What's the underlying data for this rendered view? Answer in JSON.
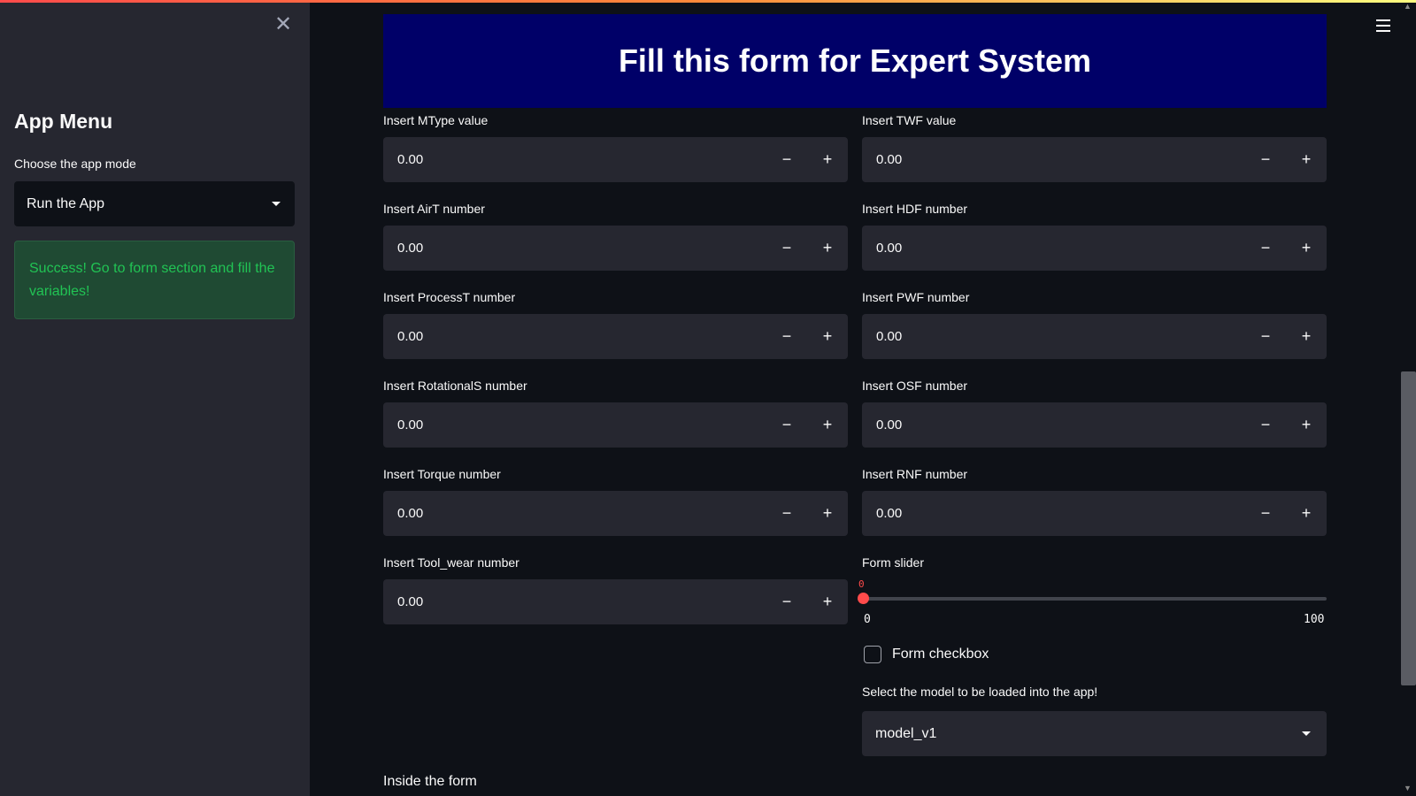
{
  "sidebar": {
    "title": "App Menu",
    "mode_label": "Choose the app mode",
    "mode_value": "Run the App",
    "success_message": "Success! Go to form section and fill the variables!"
  },
  "header": {
    "title": "Fill this form for Expert System"
  },
  "form": {
    "left_fields": [
      {
        "label": "Insert MType value",
        "value": "0.00"
      },
      {
        "label": "Insert AirT number",
        "value": "0.00"
      },
      {
        "label": "Insert ProcessT number",
        "value": "0.00"
      },
      {
        "label": "Insert RotationalS number",
        "value": "0.00"
      },
      {
        "label": "Insert Torque number",
        "value": "0.00"
      },
      {
        "label": "Insert Tool_wear number",
        "value": "0.00"
      }
    ],
    "right_fields": [
      {
        "label": "Insert TWF value",
        "value": "0.00"
      },
      {
        "label": "Insert HDF number",
        "value": "0.00"
      },
      {
        "label": "Insert PWF number",
        "value": "0.00"
      },
      {
        "label": "Insert OSF number",
        "value": "0.00"
      },
      {
        "label": "Insert RNF number",
        "value": "0.00"
      }
    ],
    "stepper": {
      "minus": "−",
      "plus": "+"
    },
    "slider": {
      "label": "Form slider",
      "value": "0",
      "min": "0",
      "max": "100"
    },
    "checkbox": {
      "label": "Form checkbox",
      "checked": false
    },
    "model_select": {
      "label": "Select the model to be loaded into the app!",
      "value": "model_v1"
    },
    "inside_text": "Inside the form"
  },
  "icons": {
    "close": "close-icon",
    "menu": "hamburger-menu-icon"
  },
  "colors": {
    "background": "#0e1117",
    "sidebar": "#262730",
    "header_banner": "#000068",
    "accent": "#ff4b4b",
    "success_text": "#21c354",
    "success_bg": "#1f4a33"
  }
}
